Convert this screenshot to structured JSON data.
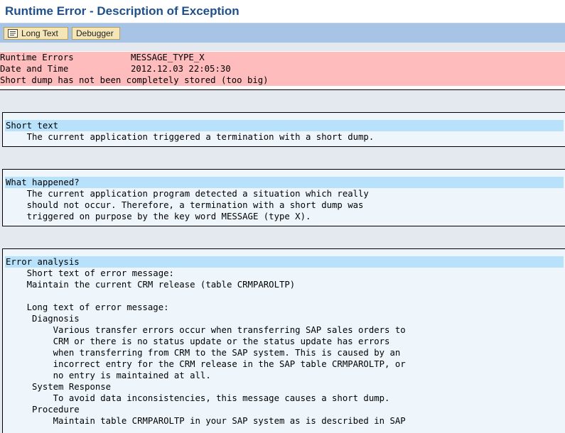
{
  "window": {
    "title": "Runtime Error - Description of Exception"
  },
  "toolbar": {
    "long_text_label": "Long Text",
    "debugger_label": "Debugger"
  },
  "header": {
    "runtime_errors_label": "Runtime Errors",
    "runtime_errors_value": "MESSAGE_TYPE_X",
    "date_time_label": "Date and Time",
    "date_time_value": "2012.12.03 22:05:30",
    "storage_note": "Short dump has not been completely stored (too big)"
  },
  "short_text": {
    "title": "Short text",
    "lines": [
      "    The current application triggered a termination with a short dump."
    ]
  },
  "what_happened": {
    "title": "What happened?",
    "lines": [
      "    The current application program detected a situation which really",
      "    should not occur. Therefore, a termination with a short dump was",
      "    triggered on purpose by the key word MESSAGE (type X)."
    ]
  },
  "error_analysis": {
    "title": "Error analysis",
    "lines": [
      "    Short text of error message:",
      "    Maintain the current CRM release (table CRMPAROLTP)",
      "",
      "    Long text of error message:",
      "     Diagnosis",
      "         Various transfer errors occur when transferring SAP sales orders to",
      "         CRM or there is no status update or the status update has errors",
      "         when transferring from CRM to the SAP system. This is caused by an",
      "         incorrect entry for the CRM release in the SAP table CRMPAROLTP, or",
      "         no entry is maintained at all.",
      "     System Response",
      "         To avoid data inconsistencies, this message causes a short dump.",
      "     Procedure",
      "         Maintain table CRMPAROLTP in your SAP system as is described in SAP"
    ]
  }
}
